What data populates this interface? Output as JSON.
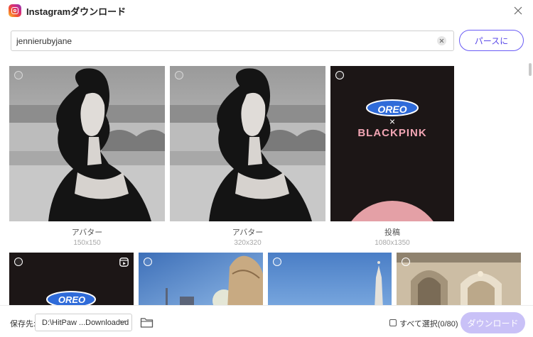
{
  "app": {
    "title": "Instagramダウンロード"
  },
  "search": {
    "value": "jennierubyjane"
  },
  "toolbar": {
    "parse_label": "パースに"
  },
  "colors": {
    "accent": "#6a5cf5",
    "download_disabled": "#c9c1f7"
  },
  "items_row1": [
    {
      "type": "アバター",
      "size": "150x150"
    },
    {
      "type": "アバター",
      "size": "320x320"
    },
    {
      "type": "投稿",
      "size": "1080x1350",
      "brand": "OREO",
      "cross": "×",
      "partner": "BLACKPINK"
    }
  ],
  "items_row2": [
    {
      "brand": "OREO",
      "has_reel_icon": true
    },
    {
      "has_reel_icon": false
    },
    {
      "has_reel_icon": false
    },
    {
      "has_reel_icon": false
    }
  ],
  "footer": {
    "save_label": "保存先:",
    "path_value": "D:\\HitPaw ...Downloaded",
    "select_all_label": "すべて選択(0/80)",
    "download_label": "ダウンロード"
  }
}
